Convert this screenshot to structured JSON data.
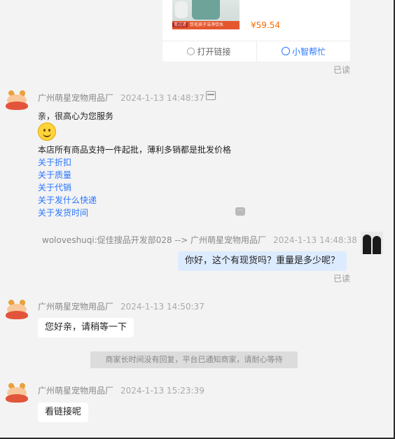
{
  "product_card": {
    "banner_tag": "宽过滤",
    "banner_text": "饮毛孩子洁净饮水",
    "price": "¥59.54",
    "open_link_icon": "link-icon",
    "open_link_label": "打开链接",
    "helper_icon": "smart-helper-icon",
    "helper_label": "小智帮忙"
  },
  "read_label": "已读",
  "messages": [
    {
      "sender": "广州萌星宠物用品厂",
      "time": "2024-1-13 14:48:37",
      "lines": [
        "亲，很高心为您服务",
        "本店所有商品支持一件起批，薄利多销都是批发价格"
      ],
      "links": [
        "关于折扣",
        "关于质量",
        "关于代销",
        "关于发什么快递",
        "关于发货时间"
      ]
    },
    {
      "sender": "woloveshuqi:促佳搜品开发部028 --> 广州萌星宠物用品厂",
      "time": "2024-1-13 14:48:38",
      "text": "你好，这个有现货吗？重量是多少呢？"
    },
    {
      "sender": "广州萌星宠物用品厂",
      "time": "2024-1-13 14:50:37",
      "text": "您好亲，请稍等一下"
    },
    {
      "sender": "广州萌星宠物用品厂",
      "time": "2024-1-13 15:23:39",
      "text": "看链接呢"
    }
  ],
  "system_notice": "商家长时间没有回复，平台已通知商家，请耐心等待",
  "colors": {
    "link": "#2a75ff",
    "price": "#ff6a00",
    "outgoing_bubble": "#dcebff",
    "background": "#f3f3f3"
  }
}
